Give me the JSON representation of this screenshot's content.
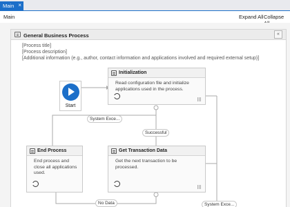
{
  "tabs": [
    {
      "label": "Main",
      "close_glyph": "×"
    }
  ],
  "designer": {
    "title": "Main",
    "expand_all": "Expand All",
    "collapse_all": "Collapse All"
  },
  "sequence": {
    "title": "General Business Process",
    "collapse_glyph": "«"
  },
  "annotations": [
    "[Process title]",
    "[Process description]",
    "[Additional information (e.g., author, contact information and applications involved and required external setup)]"
  ],
  "start": {
    "label": "Start"
  },
  "states": {
    "initialization": {
      "title": "Initialization",
      "description": "Read configuration file and initialize applications used in the process."
    },
    "end_process": {
      "title": "End Process",
      "description": "End process and close all applications used."
    },
    "get_transaction": {
      "title": "Get Transaction Data",
      "description": "Get the next transaction to be processed."
    }
  },
  "transitions": {
    "system_exception_1": "System Exce...",
    "successful": "Successful",
    "no_data": "No Data",
    "system_exception_2": "System Exce..."
  },
  "colors": {
    "accent": "#1c6fc9"
  }
}
